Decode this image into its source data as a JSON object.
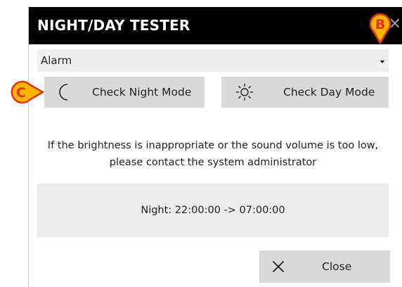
{
  "dialog": {
    "title": "NIGHT/DAY TESTER",
    "close_glyph": "✕"
  },
  "select": {
    "value": "Alarm"
  },
  "buttons": {
    "night_label": "Check Night Mode",
    "day_label": "Check Day Mode",
    "close_label": "Close"
  },
  "info": {
    "message": "If the brightness is inappropriate or the sound volume is too low, please contact the system administrator"
  },
  "schedule": {
    "text": "Night: 22:00:00 -> 07:00:00"
  },
  "annotations": {
    "badge_b": "B",
    "badge_c": "C"
  },
  "colors": {
    "titlebar": "#000000",
    "button": "#d9d9d9",
    "badge_fill": "#f7b500",
    "badge_stroke": "#e4321b"
  },
  "icons": {
    "night": "moon-icon",
    "day": "sun-icon",
    "close": "close-icon"
  }
}
